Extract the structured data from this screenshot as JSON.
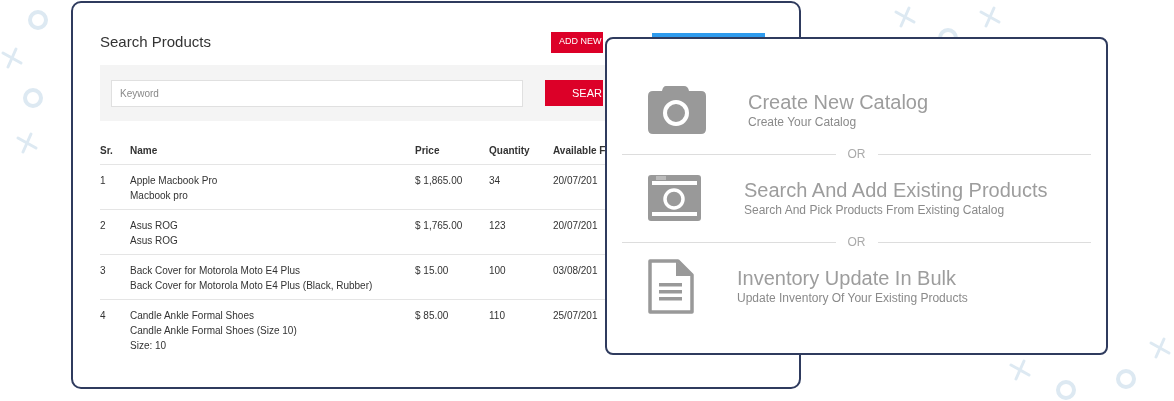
{
  "search_panel": {
    "title": "Search Products",
    "buttons": [
      {
        "label": "ADD NEW",
        "kind": "primary"
      },
      {
        "kind": "secondary"
      }
    ],
    "search": {
      "placeholder": "Keyword",
      "button": "SEAR"
    }
  },
  "table": {
    "columns": [
      "Sr.",
      "Name",
      "Price",
      "Quantity",
      "Available F"
    ],
    "rows": [
      {
        "sr": "1",
        "name": [
          "Apple Macbook Pro",
          "Macbook pro"
        ],
        "price": "$ 1,865.00",
        "quantity": "34",
        "available": "20/07/201"
      },
      {
        "sr": "2",
        "name": [
          "Asus ROG",
          "Asus ROG"
        ],
        "price": "$ 1,765.00",
        "quantity": "123",
        "available": "20/07/201"
      },
      {
        "sr": "3",
        "name": [
          "Back Cover for Motorola Moto E4 Plus",
          "Back Cover for Motorola Moto E4 Plus (Black, Rubber)"
        ],
        "price": "$ 15.00",
        "quantity": "100",
        "available": "03/08/201"
      },
      {
        "sr": "4",
        "name": [
          "Candle Ankle Formal Shoes",
          "Candle Ankle Formal Shoes (Size 10)",
          "Size: 10"
        ],
        "price": "$ 85.00",
        "quantity": "110",
        "available": "25/07/201"
      }
    ]
  },
  "options": {
    "items": [
      {
        "kind": "camera",
        "title": "Create New Catalog",
        "subtitle": "Create Your Catalog"
      },
      {
        "kind": "photo",
        "title": "Search And Add Existing Products",
        "subtitle": "Search And Pick Products From Existing Catalog"
      },
      {
        "kind": "document",
        "title": "Inventory Update In Bulk",
        "subtitle": "Update Inventory Of Your Existing Products"
      }
    ],
    "separators": [
      "OR",
      "OR"
    ]
  }
}
